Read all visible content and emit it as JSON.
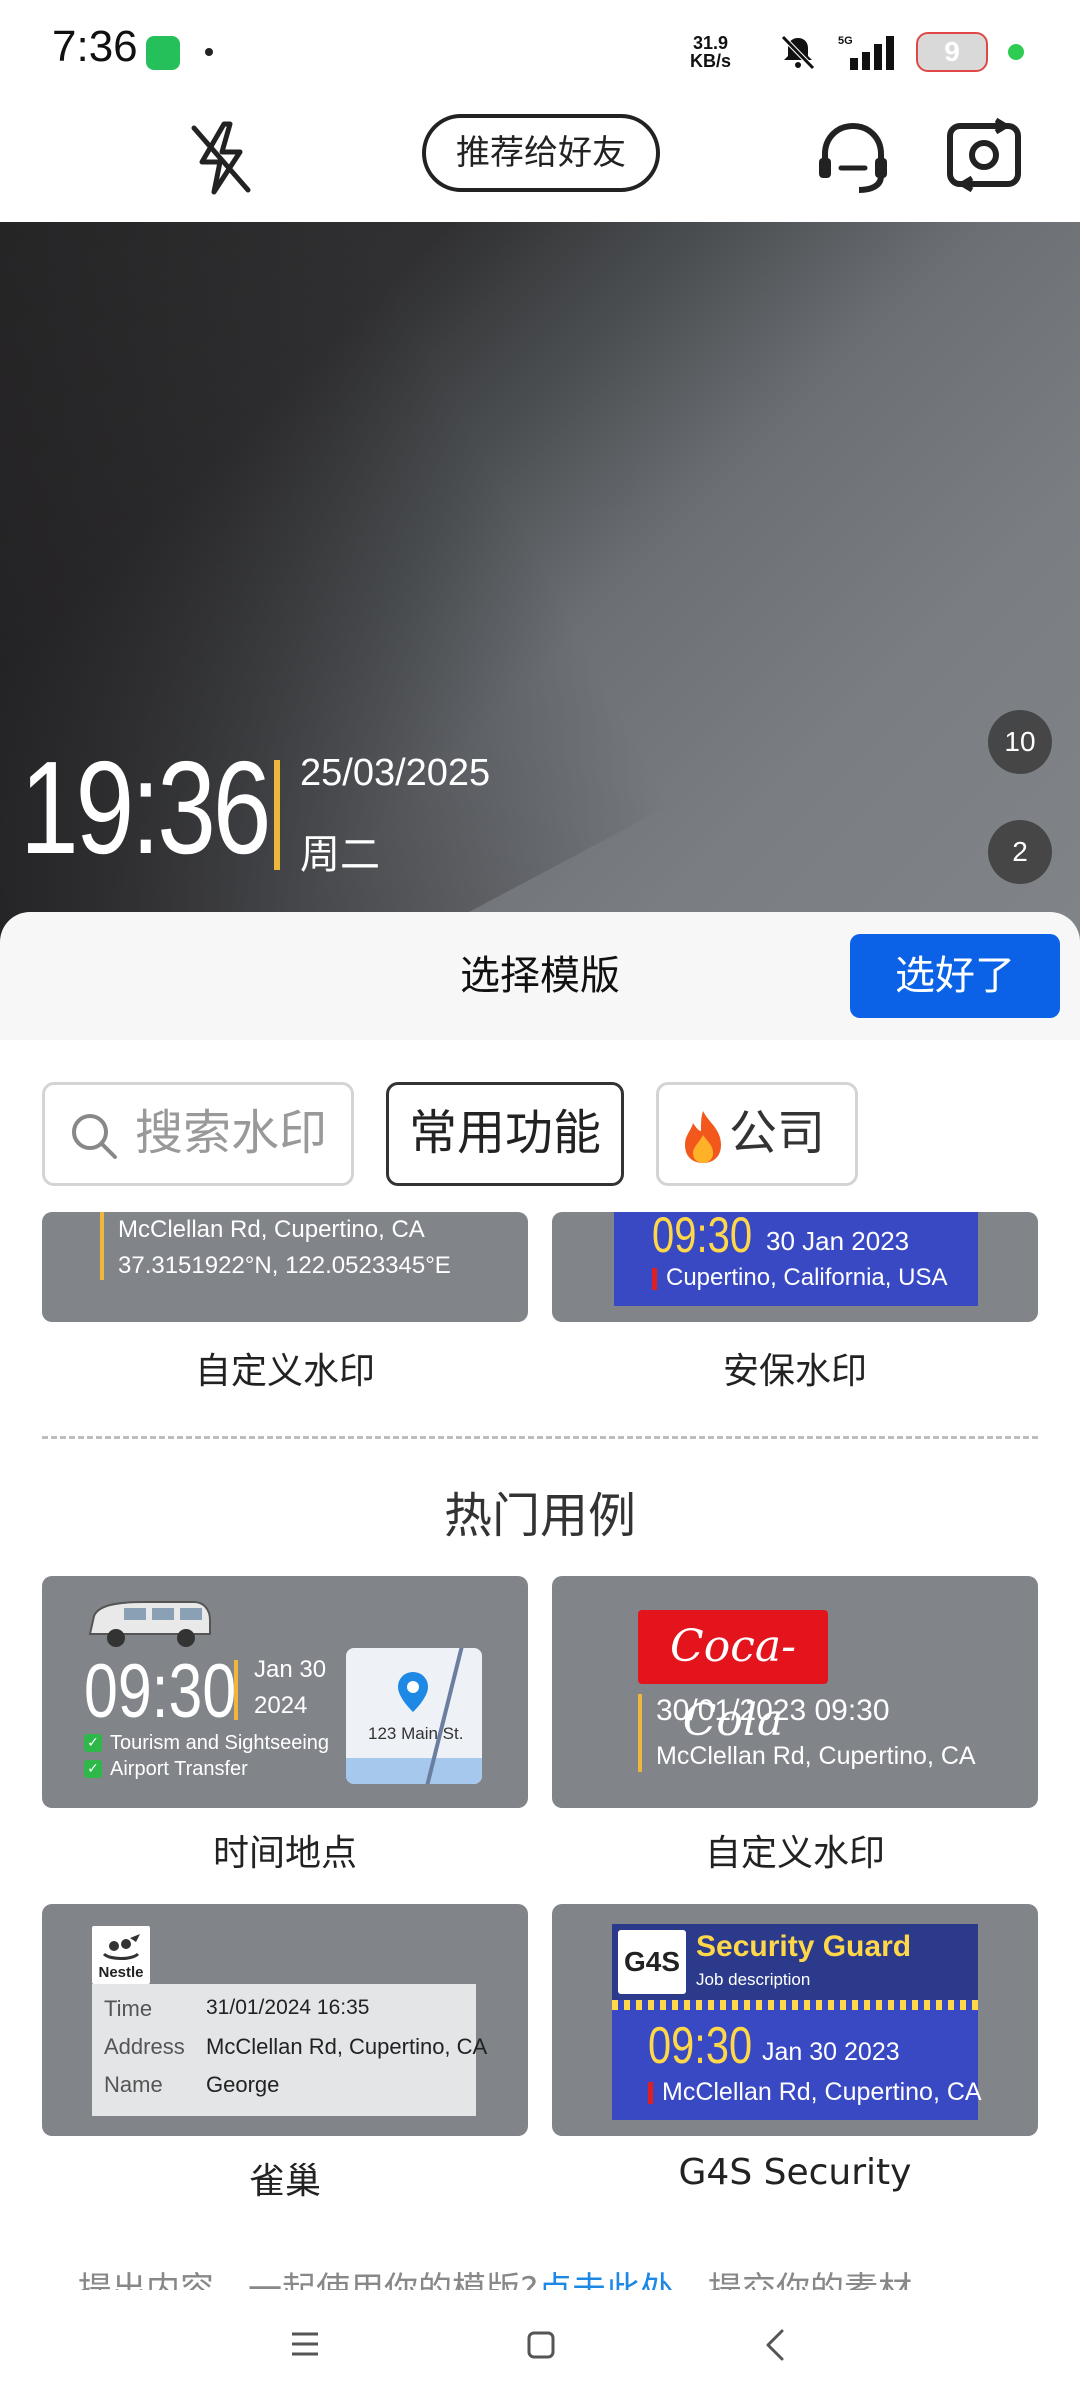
{
  "status_bar": {
    "time": "7:36",
    "speed_value": "31.9",
    "speed_unit": "KB/s",
    "network": "5G",
    "battery": "9"
  },
  "toolbar": {
    "recommend_label": "推荐给好友",
    "icons": [
      "flash-off-icon",
      "headset-icon",
      "camera-switch-icon"
    ]
  },
  "camera": {
    "time": "19:36",
    "date": "25/03/2025",
    "weekday": "周二",
    "badge_top": "10",
    "badge_bottom": "2",
    "accent": "#f0b63c"
  },
  "panel": {
    "title": "选择模版",
    "confirm_label": "选好了",
    "confirm_color": "#0b62e6"
  },
  "filters": {
    "search_placeholder": "搜索水印",
    "common": "常用功能",
    "company": "公司"
  },
  "top_cards": [
    {
      "label": "自定义水印",
      "line1": "McClellan Rd, Cupertino, CA",
      "line2": "37.3151922°N, 122.0523345°E"
    },
    {
      "label": "安保水印",
      "time": "09:30",
      "date": "30 Jan 2023",
      "place": "Cupertino, California, USA"
    }
  ],
  "hot_section": {
    "title": "热门用例"
  },
  "hot_cards": [
    {
      "label": "时间地点",
      "time": "09:30",
      "date_line1": "Jan 30",
      "date_line2": "2024",
      "check1": "Tourism and Sightseeing",
      "check2": "Airport Transfer",
      "map_text": "123 Main St."
    },
    {
      "label": "自定义水印",
      "brand": "Coca-Cola",
      "datetime": "30/01/2023  09:30",
      "place": "McClellan Rd, Cupertino, CA"
    },
    {
      "label": "雀巢",
      "logo": "Nestle",
      "rows": [
        {
          "k": "Time",
          "v": "31/01/2024 16:35"
        },
        {
          "k": "Address",
          "v": "McClellan Rd, Cupertino, CA"
        },
        {
          "k": "Name",
          "v": "George"
        }
      ]
    },
    {
      "label": "G4S Security",
      "logo": "G4S",
      "heading": "Security Guard",
      "sub": "Job description",
      "time": "09:30",
      "date": "Jan 30 2023",
      "place": "McClellan Rd, Cupertino, CA"
    }
  ],
  "bottom_hint": {
    "before": "提出内容，一起使用你的模版?",
    "link": "点击此处",
    "after": "，提交你的素材"
  },
  "nav": [
    "menu-icon",
    "home-icon",
    "back-icon"
  ]
}
